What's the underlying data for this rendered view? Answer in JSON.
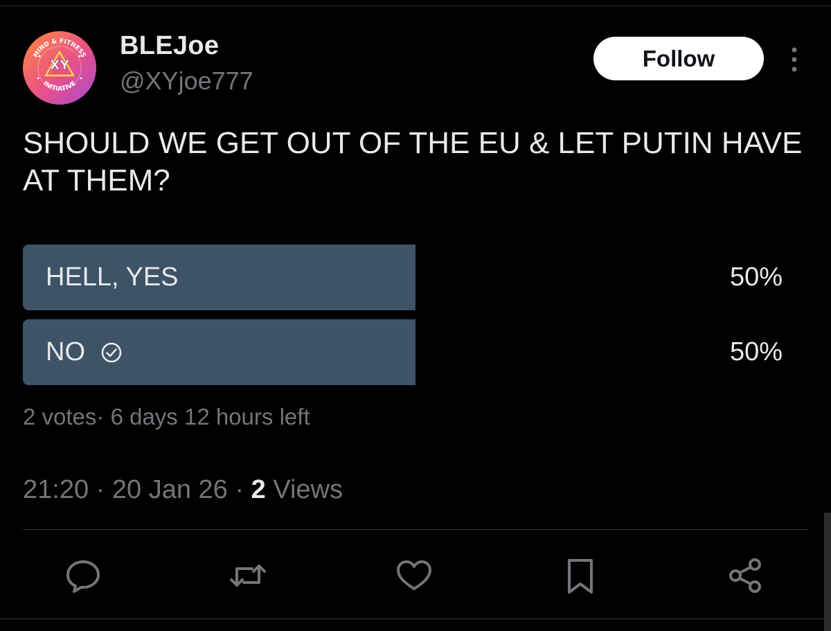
{
  "tweet": {
    "author": {
      "display_name": "BLEJoe",
      "handle": "@XYjoe777",
      "avatar": {
        "top_text": "MIND & FITNESS",
        "center_text": "XY",
        "bottom_text": "INITIATIVE"
      }
    },
    "follow_label": "Follow",
    "more_icon": "more-vertical-icon",
    "text": "SHOULD WE GET OUT OF THE EU & LET PUTIN HAVE AT THEM?",
    "poll": {
      "options": [
        {
          "label": "HELL, YES",
          "percent_label": "50%",
          "percent": 50,
          "selected": false
        },
        {
          "label": "NO",
          "percent_label": "50%",
          "percent": 50,
          "selected": true
        }
      ],
      "votes": "2 votes",
      "separator": "·",
      "time_left": "6 days 12 hours left"
    },
    "meta": {
      "time": "21:20",
      "date": "20 Jan 26",
      "views_count": "2",
      "views_label": "Views",
      "separator": "·"
    },
    "actions": [
      "reply-icon",
      "retweet-icon",
      "like-icon",
      "bookmark-icon",
      "share-icon"
    ]
  },
  "colors": {
    "background": "#000000",
    "text_primary": "#e7e9ea",
    "text_secondary": "#71767b",
    "poll_bar": "#3e5366",
    "divider": "#2f3336",
    "follow_bg": "#ffffff"
  }
}
